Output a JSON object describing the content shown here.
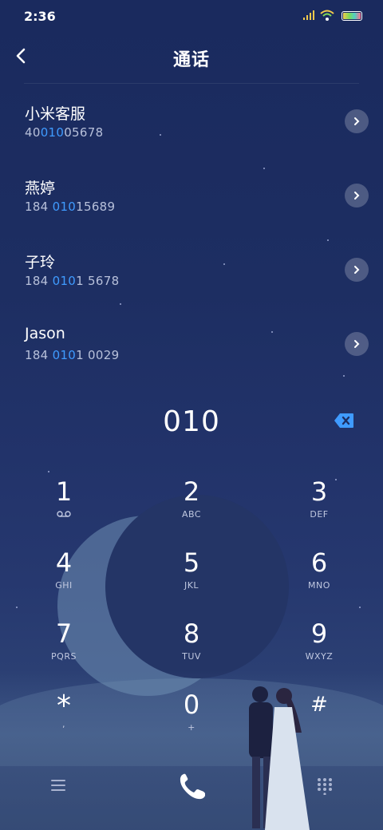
{
  "status_bar": {
    "time": "2:36"
  },
  "header": {
    "title": "通话"
  },
  "contacts": [
    {
      "name": "小米客服",
      "number_pre": "40",
      "number_hl": "010",
      "number_post": "05678"
    },
    {
      "name": "燕婷",
      "number_pre": "184 ",
      "number_hl": "010",
      "number_post": "15689"
    },
    {
      "name": "子玲",
      "number_pre": "184 ",
      "number_hl": "010",
      "number_post": "1 5678"
    },
    {
      "name": "Jason",
      "number_pre": "184 ",
      "number_hl": "010",
      "number_post": "1 0029"
    }
  ],
  "dial": {
    "input": "010"
  },
  "keypad": [
    {
      "digit": "1",
      "letters": "voicemail"
    },
    {
      "digit": "2",
      "letters": "ABC"
    },
    {
      "digit": "3",
      "letters": "DEF"
    },
    {
      "digit": "4",
      "letters": "GHI"
    },
    {
      "digit": "5",
      "letters": "JKL"
    },
    {
      "digit": "6",
      "letters": "MNO"
    },
    {
      "digit": "7",
      "letters": "PQRS"
    },
    {
      "digit": "8",
      "letters": "TUV"
    },
    {
      "digit": "9",
      "letters": "WXYZ"
    },
    {
      "digit": "*",
      "letters": ","
    },
    {
      "digit": "0",
      "letters": "+"
    },
    {
      "digit": "#",
      "letters": ""
    }
  ],
  "colors": {
    "highlight": "#3f9bff",
    "background": "#1d2e62"
  },
  "icons": {
    "back": "back-arrow-icon",
    "delete": "backspace-icon",
    "menu": "hamburger-menu-icon",
    "call": "phone-icon",
    "dialpad": "dialpad-icon",
    "voicemail": "voicemail-icon"
  }
}
